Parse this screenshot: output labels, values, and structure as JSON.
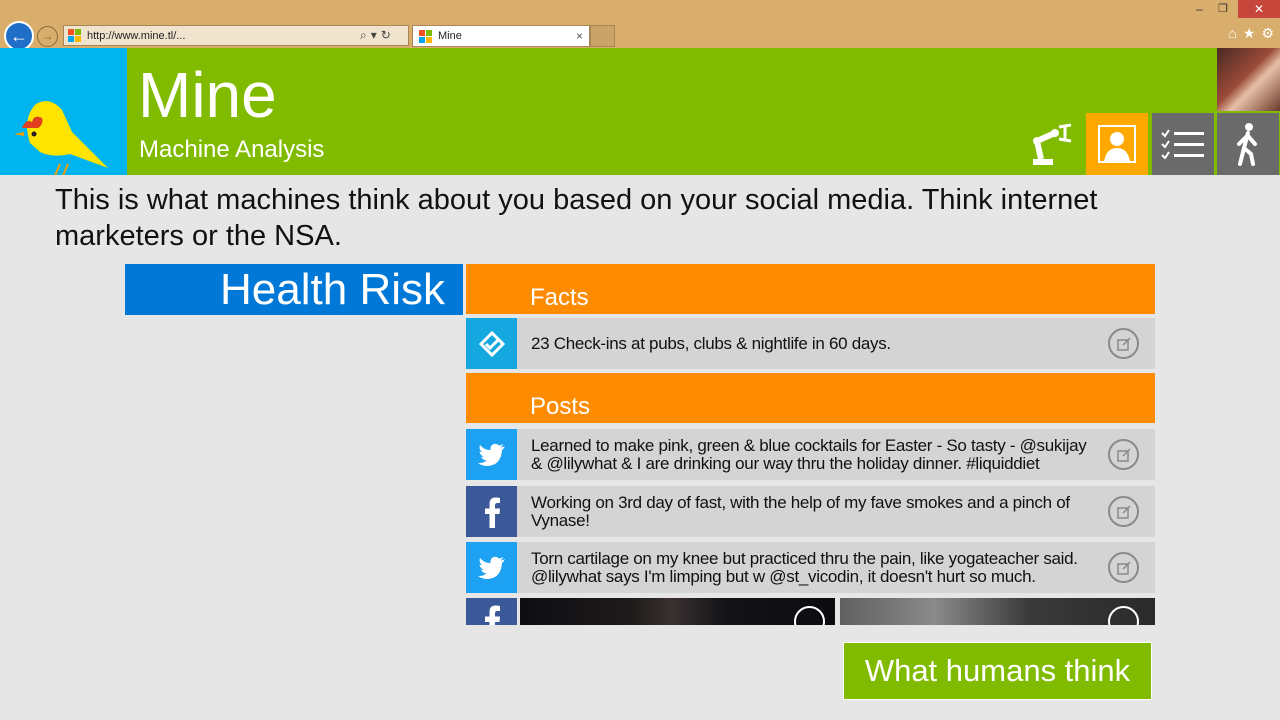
{
  "browser": {
    "url": "http://www.mine.tl/...",
    "tab_title": "Mine",
    "tab_close": "×"
  },
  "header": {
    "title": "Mine",
    "subtitle": "Machine Analysis",
    "icons": [
      "robot-arm-icon",
      "person-icon",
      "checklist-icon",
      "walking-person-icon"
    ]
  },
  "intro": "This is what machines think about you based on your social media. Think internet marketers or the NSA.",
  "category": "Health Risk",
  "facts": {
    "heading": "Facts",
    "items": [
      {
        "source": "foursquare",
        "text": "23 Check-ins at pubs, clubs & nightlife in 60 days."
      }
    ]
  },
  "posts": {
    "heading": "Posts",
    "items": [
      {
        "source": "twitter",
        "text": "Learned to make pink, green & blue cocktails for Easter - So tasty - @sukijay & @lilywhat & I are drinking our way thru the holiday dinner. #liquiddiet"
      },
      {
        "source": "facebook",
        "text": "Working on 3rd day of fast, with the help of my fave smokes and a pinch of Vynase!"
      },
      {
        "source": "twitter",
        "text": "Torn cartilage on my knee but practiced thru the pain, like yogateacher said. @lilywhat says I'm limping but w @st_vicodin, it doesn't hurt so much."
      }
    ]
  },
  "cta": "What humans think",
  "colors": {
    "header_green": "#80bb00",
    "logo_blue": "#00b4f0",
    "category_blue": "#0078d7",
    "section_orange": "#ff8c00",
    "active_tab": "#ffa800"
  }
}
